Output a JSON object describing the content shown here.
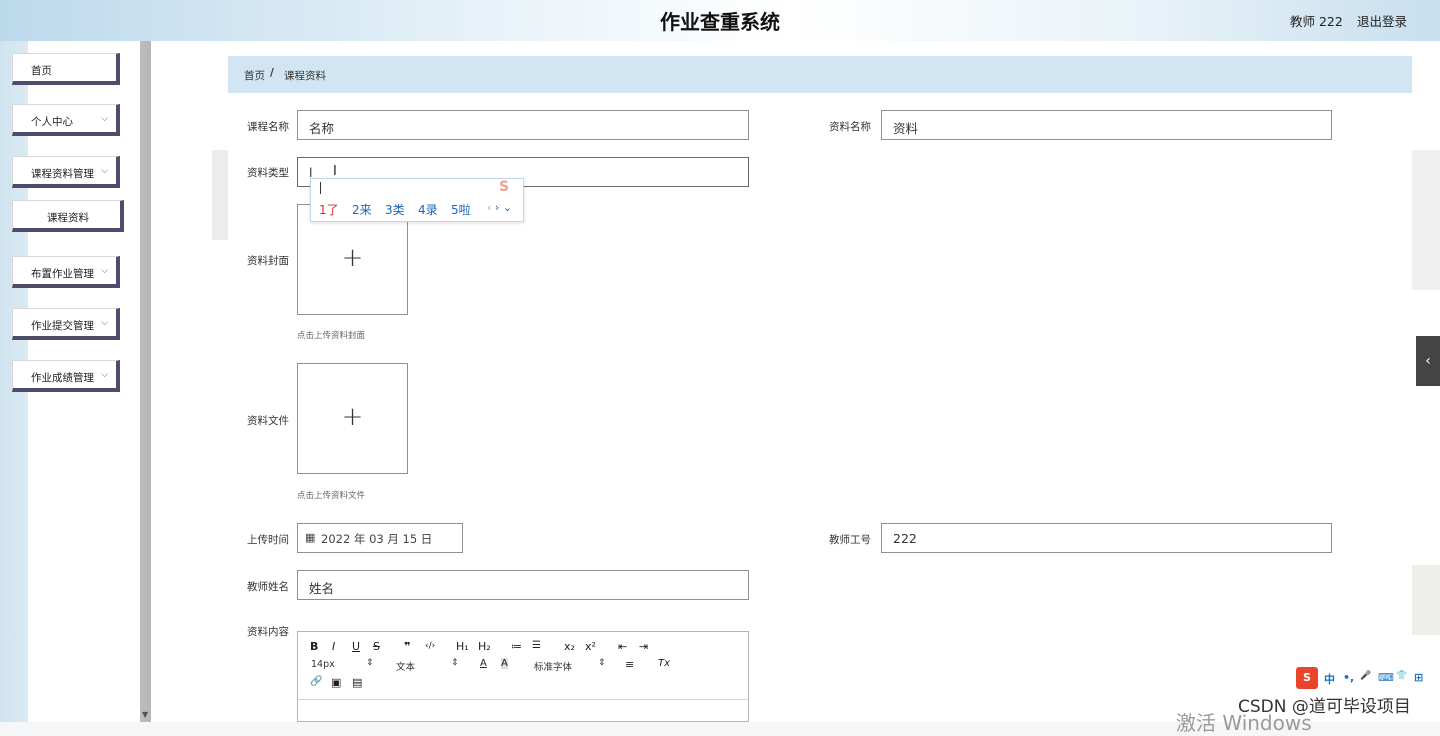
{
  "header": {
    "title": "作业查重系统",
    "user": "教师 222",
    "logout": "退出登录"
  },
  "sidebar": {
    "items": [
      {
        "label": "首页"
      },
      {
        "label": "个人中心"
      },
      {
        "label": "课程资料管理"
      },
      {
        "label": "课程资料"
      },
      {
        "label": "布置作业管理"
      },
      {
        "label": "作业提交管理"
      },
      {
        "label": "作业成绩管理"
      }
    ]
  },
  "breadcrumb": {
    "home": "首页",
    "separator": "/",
    "current": "课程资料"
  },
  "form": {
    "course_name": {
      "label": "课程名称",
      "value": "名称"
    },
    "material_name": {
      "label": "资料名称",
      "value": "资料"
    },
    "material_type": {
      "label": "资料类型",
      "value": "l"
    },
    "cover": {
      "label": "资料封面",
      "plus": "+",
      "hint": "点击上传资料封面"
    },
    "file": {
      "label": "资料文件",
      "plus": "+",
      "hint": "点击上传资料文件"
    },
    "upload_time": {
      "label": "上传时间",
      "value": "2022 年 03 月 15 日"
    },
    "teacher_id": {
      "label": "教师工号",
      "value": "222"
    },
    "teacher_name": {
      "label": "教师姓名",
      "value": "姓名"
    },
    "content": {
      "label": "资料内容"
    }
  },
  "ime_popup": {
    "composition": "l",
    "candidates": [
      "1了",
      "2来",
      "3类",
      "4录",
      "5啦"
    ],
    "prev": "‹",
    "next": "›",
    "expand": "⌄"
  },
  "editor_toolbar": {
    "bold": "B",
    "italic": "I",
    "underline": "U",
    "strike": "S",
    "quote": "❞",
    "code": "‹/›",
    "h1": "H₁",
    "h2": "H₂",
    "ordered_list": "≔",
    "bullet_list": "☰",
    "subscript": "x₂",
    "superscript": "x²",
    "outdent": "⇤",
    "indent": "⇥",
    "font_size": "14px",
    "block_format": "文本",
    "font_color": "A",
    "background": "A",
    "font_family": "标准字体",
    "align": "≡",
    "clear_format": "Tx",
    "link": "🔗",
    "image": "▣",
    "video": "▤"
  },
  "ime_bar": {
    "logo": "S",
    "items": [
      "中",
      "•,",
      "🎤",
      "⌨",
      "👕",
      "⊞"
    ]
  },
  "watermark": "CSDN @道可毕设项目",
  "activate_windows": "激活 Windows",
  "colors": {
    "breadcrumb_bg": "#d1e6f2",
    "menu_border": "#4d4d6b",
    "ime_red": "#d0372c",
    "ime_blue": "#1a66b8"
  }
}
